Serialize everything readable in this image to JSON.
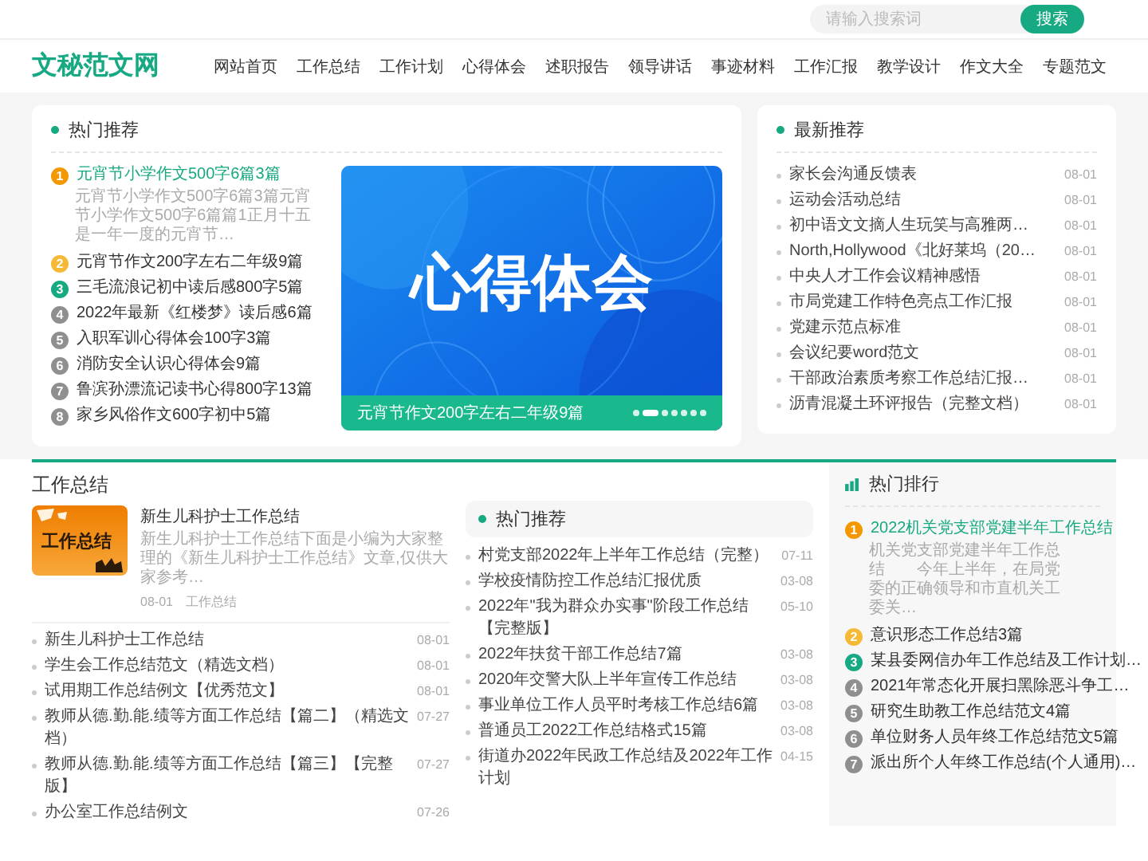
{
  "header": {
    "search": {
      "placeholder": "请输入搜索词"
    },
    "search_button": "搜索",
    "logo": "文秘范文网",
    "nav": [
      "网站首页",
      "工作总结",
      "工作计划",
      "心得体会",
      "述职报告",
      "领导讲话",
      "事迹材料",
      "工作汇报",
      "教学设计",
      "作文大全",
      "专题范文"
    ]
  },
  "hot": {
    "title": "热门推荐",
    "items": [
      {
        "rank": "1",
        "color": "#f39800",
        "expanded": true,
        "title": "元宵节小学作文500字6篇3篇",
        "summary": "元宵节小学作文500字6篇3篇元宵节小学作文500字6篇篇1正月十五是一年一度的元宵节…"
      },
      {
        "rank": "2",
        "color": "#f5b935",
        "expanded": false,
        "title": "元宵节作文200字左右二年级9篇"
      },
      {
        "rank": "3",
        "color": "#16a982",
        "expanded": false,
        "title": "三毛流浪记初中读后感800字5篇"
      },
      {
        "rank": "4",
        "color": "#8f8f8f",
        "expanded": false,
        "title": "2022年最新《红楼梦》读后感6篇"
      },
      {
        "rank": "5",
        "color": "#8f8f8f",
        "expanded": false,
        "title": "入职军训心得体会100字3篇"
      },
      {
        "rank": "6",
        "color": "#8f8f8f",
        "expanded": false,
        "title": "消防安全认识心得体会9篇"
      },
      {
        "rank": "7",
        "color": "#8f8f8f",
        "expanded": false,
        "title": "鲁滨孙漂流记读书心得800字13篇"
      },
      {
        "rank": "8",
        "color": "#8f8f8f",
        "expanded": false,
        "title": "家乡风俗作文600字初中5篇"
      }
    ],
    "banner": {
      "headline": "心得体会",
      "caption": "元宵节作文200字左右二年级9篇",
      "dots": [
        {
          "selected": false
        },
        {
          "selected": true
        },
        {
          "selected": false
        },
        {
          "selected": false
        },
        {
          "selected": false
        },
        {
          "selected": false
        },
        {
          "selected": false
        }
      ]
    }
  },
  "latest": {
    "title": "最新推荐",
    "items": [
      {
        "title": "家长会沟通反馈表",
        "date": "08-01"
      },
      {
        "title": "运动会活动总结",
        "date": "08-01"
      },
      {
        "title": "初中语文文摘人生玩笑与高雅两…",
        "date": "08-01"
      },
      {
        "title": "North,Hollywood《北好莱坞（20…",
        "date": "08-01"
      },
      {
        "title": "中央人才工作会议精神感悟",
        "date": "08-01"
      },
      {
        "title": "市局党建工作特色亮点工作汇报",
        "date": "08-01"
      },
      {
        "title": "党建示范点标准",
        "date": "08-01"
      },
      {
        "title": "会议纪要word范文",
        "date": "08-01"
      },
      {
        "title": "干部政治素质考察工作总结汇报…",
        "date": "08-01"
      },
      {
        "title": "沥青混凝土环评报告（完整文档）",
        "date": "08-01"
      }
    ]
  },
  "work_summary": {
    "title": "工作总结",
    "feature": {
      "image_label": "工作总结",
      "title": "新生儿科护士工作总结",
      "summary": "新生儿科护士工作总结下面是小编为大家整理的《新生儿科护士工作总结》文章,仅供大家参考…",
      "date": "08-01",
      "category": "工作总结"
    },
    "items": [
      {
        "title": "新生儿科护士工作总结",
        "date": "08-01"
      },
      {
        "title": "学生会工作总结范文（精选文档）",
        "date": "08-01"
      },
      {
        "title": "试用期工作总结例文【优秀范文】",
        "date": "08-01"
      },
      {
        "title": "教师从德.勤.能.绩等方面工作总结【篇二】（精选文档）",
        "date": "07-27"
      },
      {
        "title": "教师从德.勤.能.绩等方面工作总结【篇三】【完整版】",
        "date": "07-27"
      },
      {
        "title": "办公室工作总结例文",
        "date": "07-26"
      }
    ]
  },
  "hot_box": {
    "title": "热门推荐",
    "items": [
      {
        "title": "村党支部2022年上半年工作总结（完整）",
        "date": "07-11"
      },
      {
        "title": "学校疫情防控工作总结汇报优质",
        "date": "03-08"
      },
      {
        "title": "2022年\"我为群众办实事\"阶段工作总结【完整版】",
        "date": "05-10"
      },
      {
        "title": "2022年扶贫干部工作总结7篇",
        "date": "03-08"
      },
      {
        "title": "2020年交警大队上半年宣传工作总结",
        "date": "03-08"
      },
      {
        "title": "事业单位工作人员平时考核工作总结6篇",
        "date": "03-08"
      },
      {
        "title": "普通员工2022工作总结格式15篇",
        "date": "03-08"
      },
      {
        "title": "街道办2022年民政工作总结及2022年工作计划",
        "date": "04-15"
      }
    ]
  },
  "ranking": {
    "title": "热门排行",
    "items": [
      {
        "rank": "1",
        "color": "#f39800",
        "expanded": true,
        "title": "2022机关党支部党建半年工作总结",
        "summary": "机关党支部党建半年工作总结　　今年上半年，在局党委的正确领导和市直机关工委关…"
      },
      {
        "rank": "2",
        "color": "#f5b935",
        "expanded": false,
        "title": "意识形态工作总结3篇"
      },
      {
        "rank": "3",
        "color": "#16a982",
        "expanded": false,
        "title": "某县委网信办年工作总结及工作计划…"
      },
      {
        "rank": "4",
        "color": "#8f8f8f",
        "expanded": false,
        "title": "2021年常态化开展扫黑除恶斗争工…"
      },
      {
        "rank": "5",
        "color": "#8f8f8f",
        "expanded": false,
        "title": "研究生助教工作总结范文4篇"
      },
      {
        "rank": "6",
        "color": "#8f8f8f",
        "expanded": false,
        "title": "单位财务人员年终工作总结范文5篇"
      },
      {
        "rank": "7",
        "color": "#8f8f8f",
        "expanded": false,
        "title": "派出所个人年终工作总结(个人通用)…"
      }
    ]
  }
}
